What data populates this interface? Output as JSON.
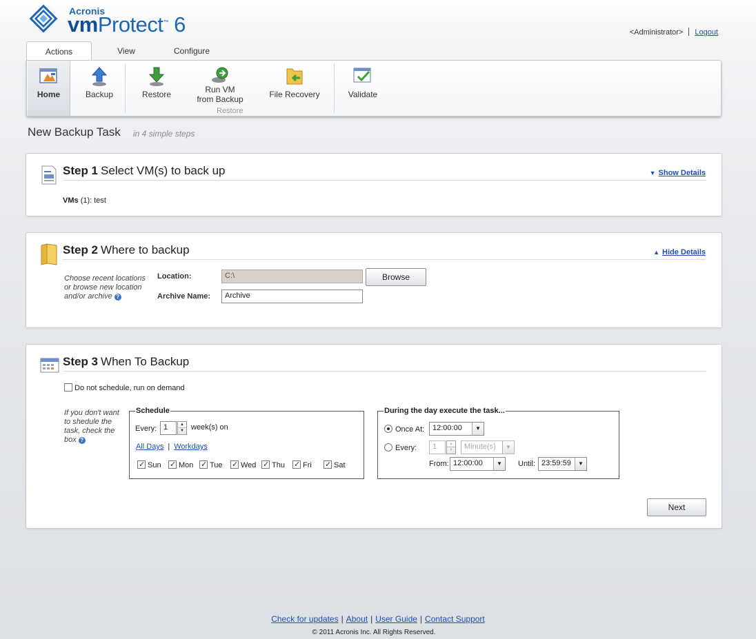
{
  "brand": {
    "company": "Acronis",
    "product_prefix": "vm",
    "product_name": "Protect",
    "version": "6",
    "tm": "™"
  },
  "user": {
    "name": "<Administrator>",
    "logout": "Logout"
  },
  "tabs": [
    {
      "label": "Actions"
    },
    {
      "label": "View"
    },
    {
      "label": "Configure"
    }
  ],
  "ribbon": {
    "home": "Home",
    "backup": "Backup",
    "restore": "Restore",
    "run_vm_line1": "Run VM",
    "run_vm_line2": "from Backup",
    "file_recovery": "File Recovery",
    "validate": "Validate",
    "restore_group": "Restore"
  },
  "page": {
    "title": "New Backup Task",
    "subtitle": "in 4 simple steps"
  },
  "step1": {
    "num": "Step 1",
    "title": "Select VM(s) to back up",
    "details": "Show Details",
    "vms_label": "VMs",
    "vms_count": "(1): test"
  },
  "step2": {
    "num": "Step 2",
    "title": "Where to backup",
    "details": "Hide Details",
    "hint_line1": "Choose recent locations",
    "hint_line2": "or browse new location",
    "hint_line3": "and/or archive",
    "location_label": "Location:",
    "location_value": "C:\\",
    "browse": "Browse",
    "archive_label": "Archive Name:",
    "archive_value": "Archive"
  },
  "step3": {
    "num": "Step 3",
    "title": "When To Backup",
    "no_schedule": "Do not schedule, run on demand",
    "hint_line1": "If you don't want",
    "hint_line2": "to shedule the",
    "hint_line3": "task, check the",
    "hint_line4": "box",
    "schedule": {
      "legend": "Schedule",
      "every_label": "Every:",
      "every_value": "1",
      "unit": "week(s) on",
      "all_days": "All Days",
      "workdays": "Workdays",
      "days": [
        "Sun",
        "Mon",
        "Tue",
        "Wed",
        "Thu",
        "Fri",
        "Sat"
      ]
    },
    "during": {
      "legend": "During the day execute the task...",
      "once_label": "Once At:",
      "once_value": "12:00:00",
      "every_label": "Every:",
      "every_value": "1",
      "every_unit": "Minute(s)",
      "from_label": "From:",
      "from_value": "12:00:00",
      "until_label": "Until:",
      "until_value": "23:59:59"
    },
    "next": "Next"
  },
  "footer": {
    "check_updates": "Check for updates",
    "about": "About",
    "user_guide": "User Guide",
    "contact": "Contact Support",
    "copyright": "© 2011 Acronis Inc. All Rights Reserved."
  }
}
